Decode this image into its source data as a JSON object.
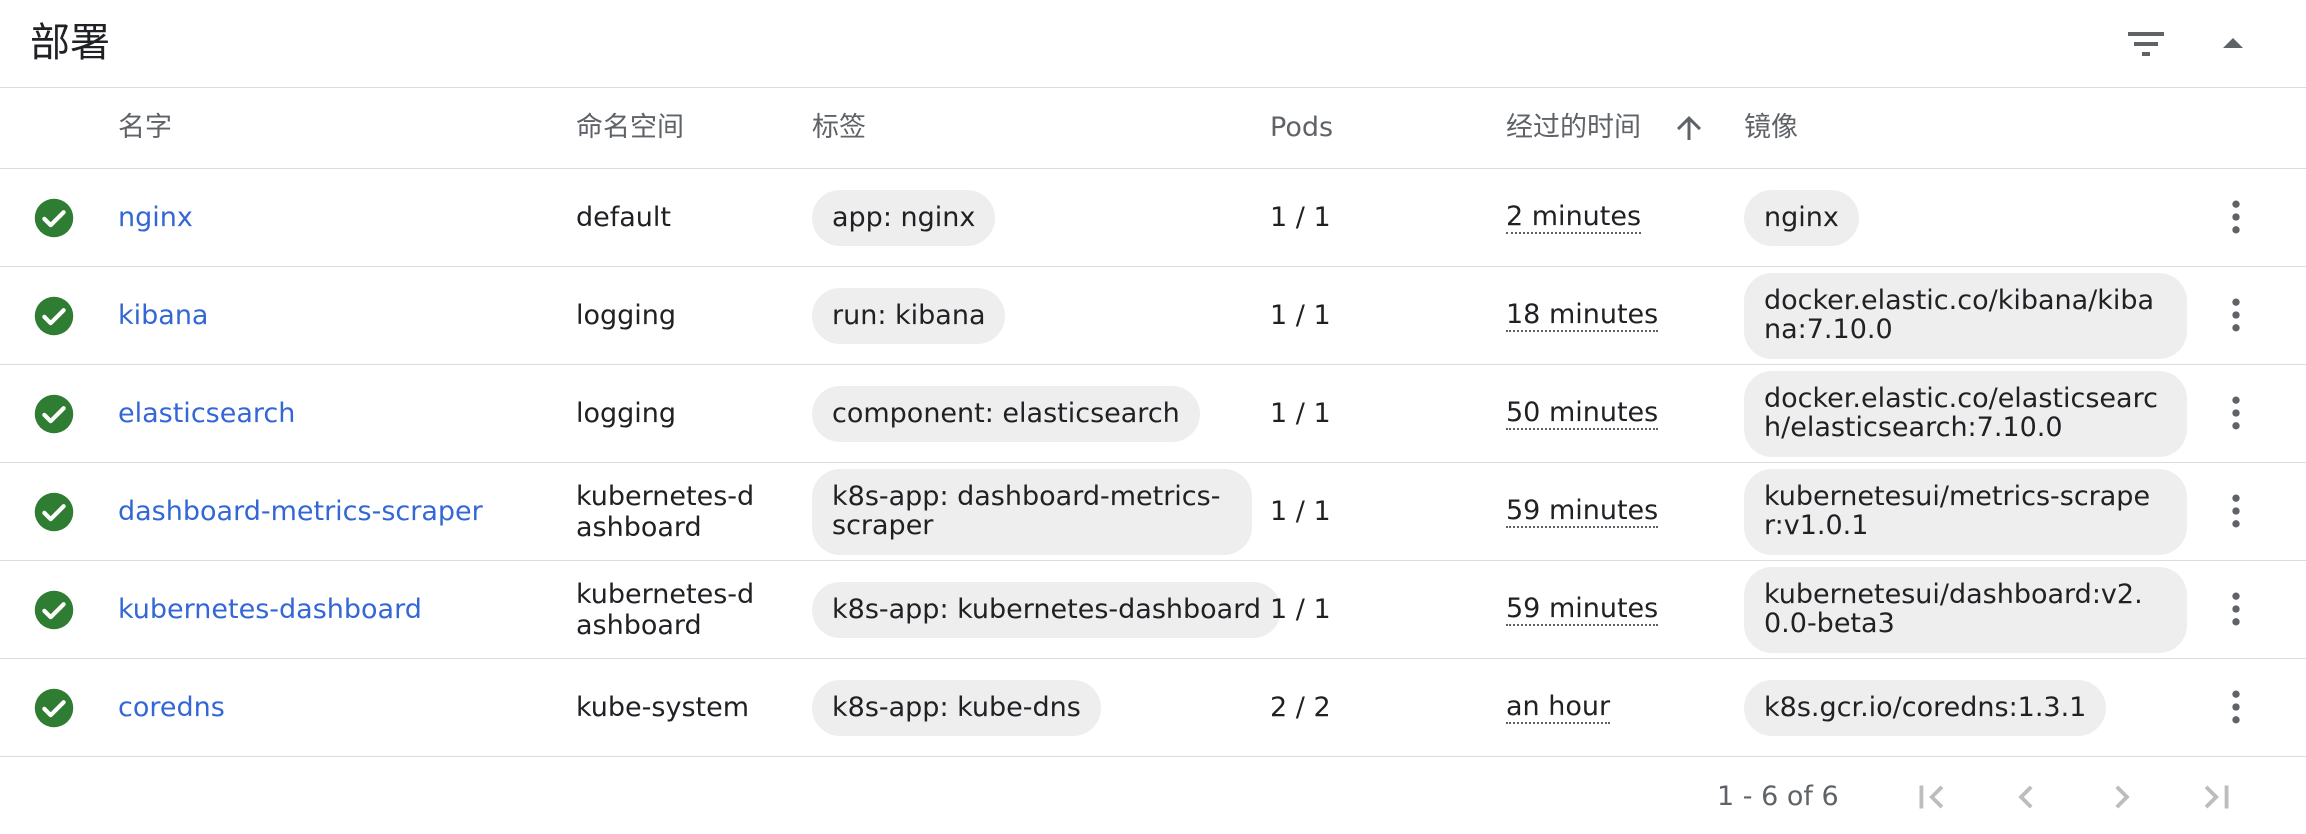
{
  "card": {
    "title": "部署"
  },
  "icons": {
    "filter": "filter-list-icon",
    "collapse": "arrow-drop-up-icon",
    "sort": "arrow-upward-icon",
    "status": "check-circle-icon",
    "more": "more-vert-icon"
  },
  "colors": {
    "link": "#3367d6",
    "success": "#2e7d32",
    "chip": "#eeeeee",
    "divider": "#dadce0"
  },
  "columns": {
    "name": "名字",
    "namespace": "命名空间",
    "labels": "标签",
    "pods": "Pods",
    "age": "经过的时间",
    "images": "镜像"
  },
  "rows": [
    {
      "status": "success",
      "name": "nginx",
      "namespace": "default",
      "label": "app: nginx",
      "pods": "1 / 1",
      "age": "2 minutes",
      "image": "nginx"
    },
    {
      "status": "success",
      "name": "kibana",
      "namespace": "logging",
      "label": "run: kibana",
      "pods": "1 / 1",
      "age": "18 minutes",
      "image": "docker.elastic.co/kibana/kibana:7.10.0"
    },
    {
      "status": "success",
      "name": "elasticsearch",
      "namespace": "logging",
      "label": "component: elasticsearch",
      "pods": "1 / 1",
      "age": "50 minutes",
      "image": "docker.elastic.co/elasticsearch/elasticsearch:7.10.0"
    },
    {
      "status": "success",
      "name": "dashboard-metrics-scraper",
      "namespace": "kubernetes-dashboard",
      "label": "k8s-app: dashboard-metrics-scraper",
      "pods": "1 / 1",
      "age": "59 minutes",
      "image": "kubernetesui/metrics-scraper:v1.0.1"
    },
    {
      "status": "success",
      "name": "kubernetes-dashboard",
      "namespace": "kubernetes-dashboard",
      "label": "k8s-app: kubernetes-dashboard",
      "pods": "1 / 1",
      "age": "59 minutes",
      "image": "kubernetesui/dashboard:v2.0.0-beta3"
    },
    {
      "status": "success",
      "name": "coredns",
      "namespace": "kube-system",
      "label": "k8s-app: kube-dns",
      "pods": "2 / 2",
      "age": "an hour",
      "image": "k8s.gcr.io/coredns:1.3.1"
    }
  ],
  "pagination": {
    "range": "1 - 6 of 6"
  }
}
